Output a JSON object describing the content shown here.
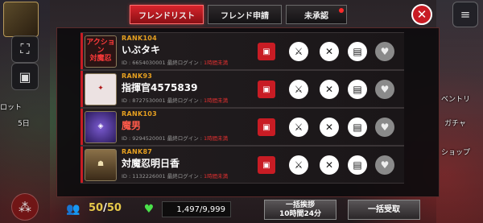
{
  "tabs": [
    {
      "label": "フレンドリスト",
      "active": true
    },
    {
      "label": "フレンド申請",
      "active": false
    },
    {
      "label": "未承認",
      "active": false,
      "has_notification": true
    }
  ],
  "friends": [
    {
      "rank": "RANK104",
      "name": "いぶタキ",
      "id_label": "ID : 6654030001",
      "login_label": "最終ログイン :",
      "login_value": "1時間未満",
      "avatar_text": "アクション\n対魔忍",
      "avatar_color": "#2a1414",
      "name_color": "#ffffff"
    },
    {
      "rank": "RANK93",
      "name": "指揮官4575839",
      "id_label": "ID : 8727530001",
      "login_label": "最終ログイン :",
      "login_value": "1時間未満",
      "avatar_text": "",
      "avatar_color": "#e8dcdc",
      "name_color": "#ffffff"
    },
    {
      "rank": "RANK103",
      "name": "魔男",
      "id_label": "ID : 9294520001",
      "login_label": "最終ログイン :",
      "login_value": "1時間未満",
      "avatar_text": "",
      "avatar_color": "#3a2a6a",
      "name_color": "#ff5a4a"
    },
    {
      "rank": "RANK87",
      "name": "対魔忍明日香",
      "id_label": "ID : 1132226001",
      "login_label": "最終ログイン :",
      "login_value": "1時間未満",
      "avatar_text": "",
      "avatar_color": "#6a5a3a",
      "name_color": "#ffffff"
    }
  ],
  "bottom": {
    "friend_count": "50",
    "friend_max": "50",
    "stamina_text": "1,497/9,999",
    "greet_all_label": "一括挨拶",
    "greet_all_timer": "10時間24分",
    "receive_all_label": "一括受取"
  },
  "side": {
    "day_label": "5日",
    "right_labels": [
      "ベントリ",
      "ガチャ",
      "ショップ"
    ],
    "left_labels": [
      "ロット"
    ]
  },
  "colors": {
    "accent_red": "#c81c24",
    "rank_gold": "#e6a020"
  }
}
